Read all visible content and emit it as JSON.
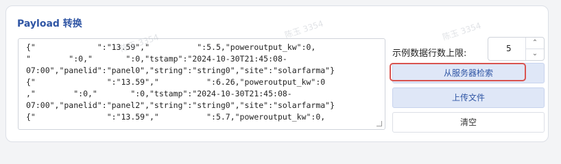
{
  "panel": {
    "title": "Payload 转换"
  },
  "payload": {
    "lines": [
      "{\"             \":\"13.59\",\"          \":5.5,\"poweroutput_kw\":0,",
      "\"        \":0,\"       \":0,\"tstamp\":\"2024-10-30T21:45:08-",
      "07:00\",\"panelid\":\"panel0\",\"string\":\"string0\",\"site\":\"solarfarma\"}",
      "{\"               \":\"13.59\",\"          \":6.26,\"poweroutput_kw\":0",
      ",\"        \":0,\"       \":0,\"tstamp\":\"2024-10-30T21:45:08-",
      "07:00\",\"panelid\":\"panel2\",\"string\":\"string0\",\"site\":\"solarfarma\"}",
      "{\"               \":\"13.59\",\"          \":5.7,\"poweroutput_kw\":0,"
    ]
  },
  "controls": {
    "limit_label": "示例数据行数上限:",
    "limit_value": "5",
    "search_button": "从服务器检索",
    "upload_button": "上传文件",
    "clear_button": "清空"
  },
  "watermark": {
    "text": "陈玉 3354"
  },
  "colors": {
    "accent": "#2f55a4",
    "highlight": "#d9534f",
    "button_bg": "#dfe7f7"
  },
  "icons": {
    "up": "chevron-up-icon",
    "down": "chevron-down-icon"
  }
}
